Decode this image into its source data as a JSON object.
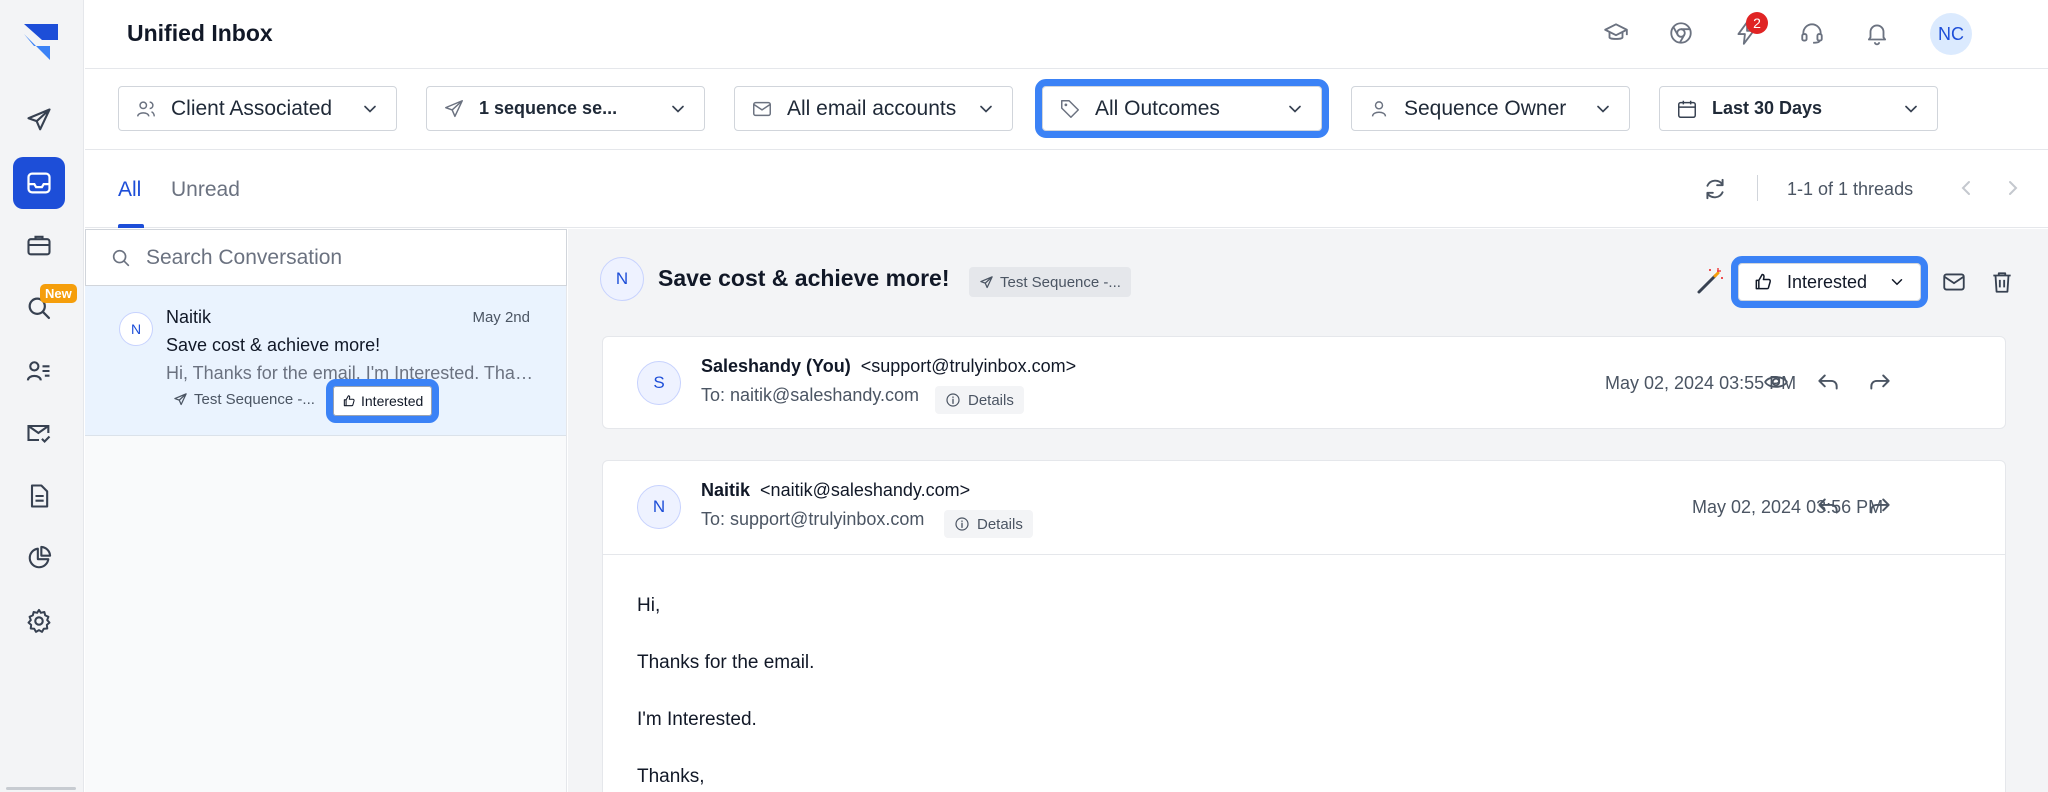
{
  "header": {
    "title": "Unified Inbox",
    "notification_count": "2",
    "user_initials": "NC"
  },
  "sidebar": {
    "new_badge": "New",
    "items": [
      "campaign-icon",
      "inbox-icon",
      "briefcase-icon",
      "lead-finder-icon",
      "prospects-icon",
      "email-accounts-icon",
      "templates-icon",
      "reports-icon",
      "settings-icon"
    ]
  },
  "filters": {
    "client": "Client Associated",
    "sequence": "1 sequence se...",
    "email_accounts": "All email accounts",
    "outcomes": "All Outcomes",
    "owner": "Sequence Owner",
    "date_range": "Last 30 Days"
  },
  "tabs": {
    "all": "All",
    "unread": "Unread",
    "pager": "1-1 of 1 threads"
  },
  "search": {
    "placeholder": "Search Conversation"
  },
  "conversation": {
    "avatar": "N",
    "name": "Naitik",
    "date": "May 2nd",
    "subject": "Save cost & achieve more!",
    "preview": "Hi, Thanks for the email. I'm Interested. Thanks,",
    "sequence_tag": "Test Sequence -...",
    "outcome": "Interested"
  },
  "detail": {
    "avatar": "N",
    "subject": "Save cost & achieve more!",
    "sequence_tag": "Test Sequence -...",
    "outcome": "Interested",
    "messages": [
      {
        "avatar": "S",
        "from_name": "Saleshandy (You)",
        "from_email": "<support@trulyinbox.com>",
        "to": "To: naitik@saleshandy.com",
        "details_label": "Details",
        "date": "May 02, 2024 03:55 PM"
      },
      {
        "avatar": "N",
        "from_name": "Naitik",
        "from_email": "<naitik@saleshandy.com>",
        "to": "To: support@trulyinbox.com",
        "details_label": "Details",
        "date": "May 02, 2024 03:56 PM",
        "body": [
          "Hi,",
          "Thanks for the email.",
          "I'm Interested.",
          "Thanks,"
        ]
      }
    ]
  },
  "colors": {
    "accent": "#1d4ed8",
    "highlight": "#3b82f6",
    "badge_red": "#e02424",
    "new_badge": "#f59e0b"
  }
}
